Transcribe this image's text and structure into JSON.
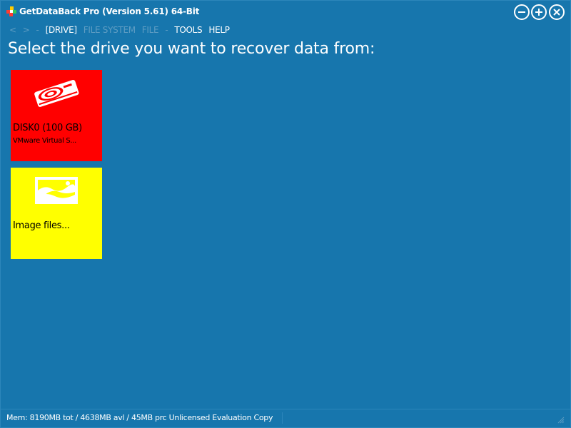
{
  "window": {
    "title": "GetDataBack Pro (Version 5.61) 64-Bit"
  },
  "menu": {
    "back": "<",
    "forward": ">",
    "sep1": "-",
    "drive": "[DRIVE]",
    "file_system": "FILE SYSTEM",
    "file": "FILE",
    "sep2": "-",
    "tools": "TOOLS",
    "help": "HELP"
  },
  "heading": "Select the drive you want to recover data from:",
  "tiles": [
    {
      "label": "DISK0 (100 GB)",
      "sub": "VMware Virtual S...",
      "icon": "hard-disk-icon",
      "color": "#ff0000"
    },
    {
      "label": "Image files...",
      "icon": "image-file-icon",
      "color": "#ffff00"
    }
  ],
  "status": {
    "text": "Mem: 8190MB tot / 4638MB avl / 45MB prc  Unlicensed Evaluation Copy"
  },
  "colors": {
    "background": "#1776ad",
    "disabled_text": "#5f9dc3",
    "text": "#ffffff"
  }
}
